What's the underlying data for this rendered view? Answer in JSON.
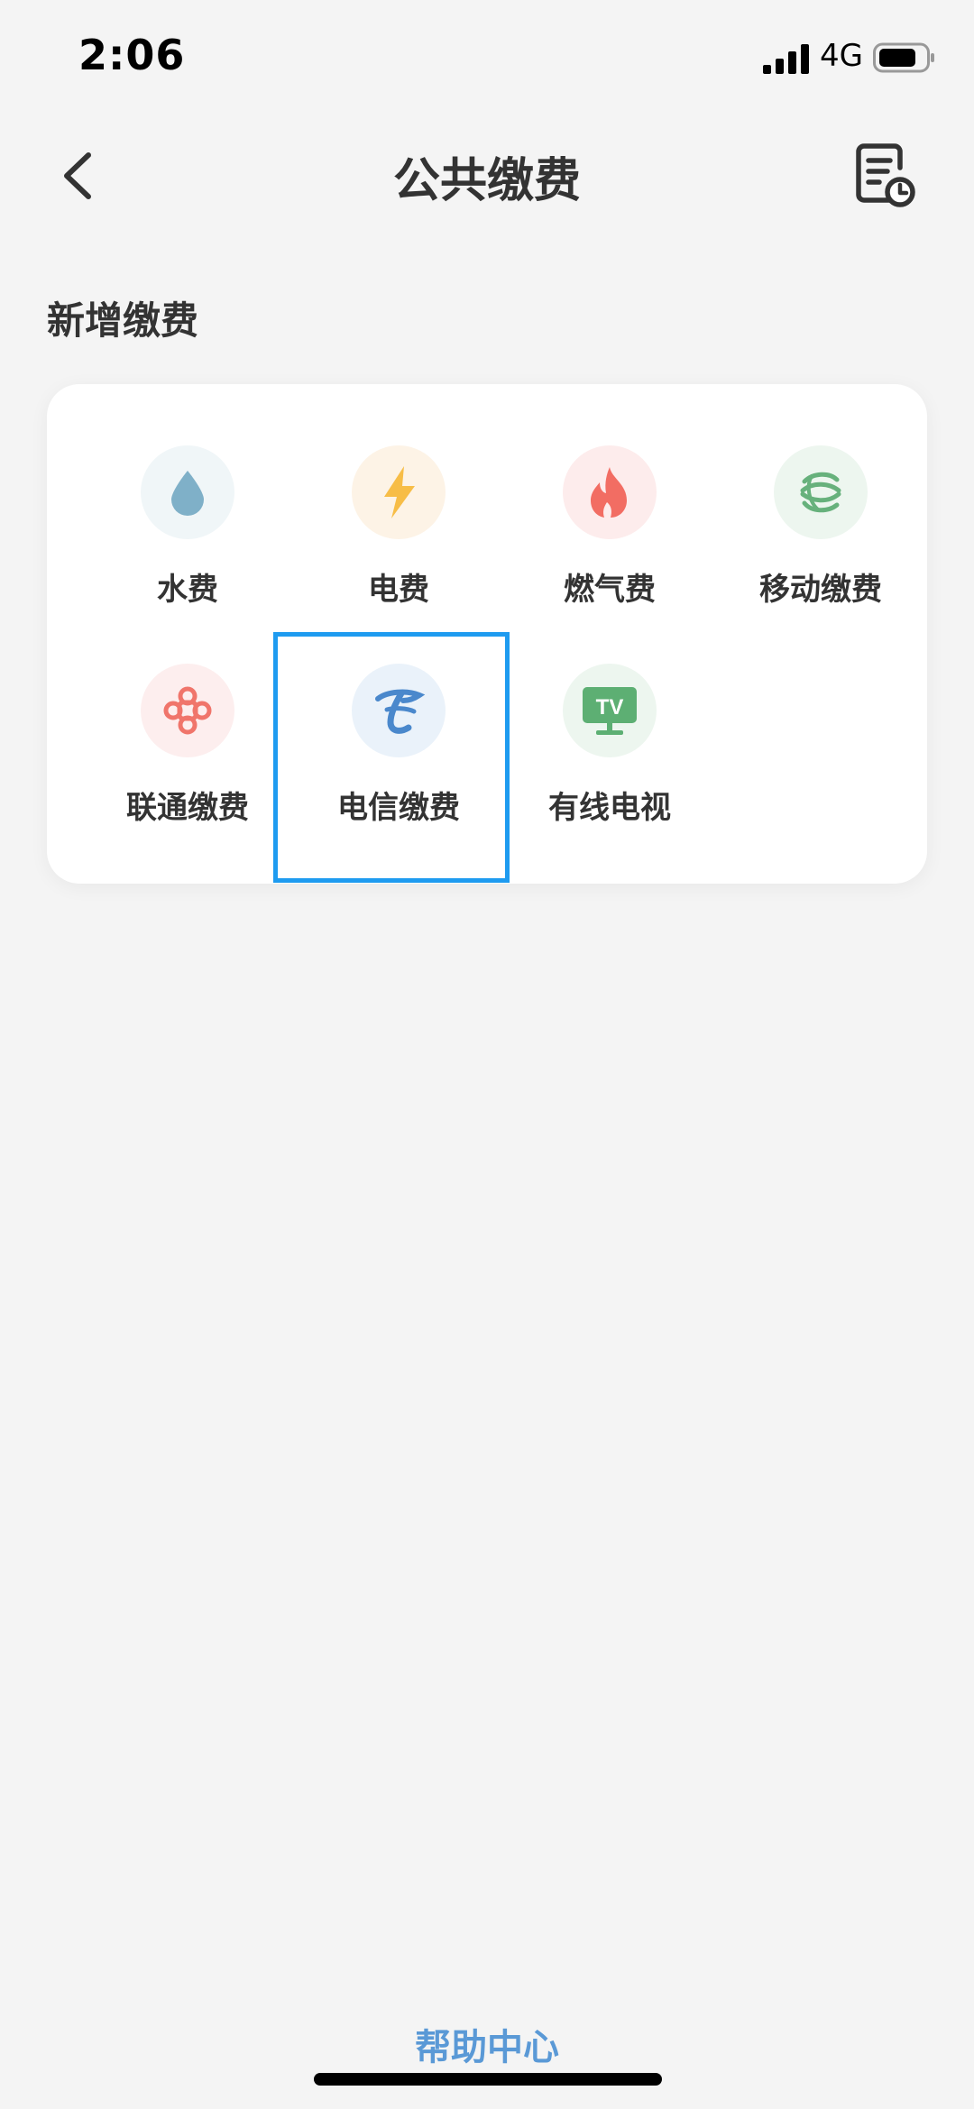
{
  "status_bar": {
    "time": "2:06",
    "network": "4G"
  },
  "nav": {
    "title": "公共缴费"
  },
  "section": {
    "title": "新增缴费"
  },
  "payment_items": [
    {
      "label": "水费",
      "icon": "water-drop-icon",
      "color": "#7fb0c8",
      "bg": "#f0f6f8"
    },
    {
      "label": "电费",
      "icon": "lightning-icon",
      "color": "#f7bd47",
      "bg": "#fdf3e6"
    },
    {
      "label": "燃气费",
      "icon": "flame-icon",
      "color": "#f26d63",
      "bg": "#fdecec"
    },
    {
      "label": "移动缴费",
      "icon": "china-mobile-icon",
      "color": "#67b17c",
      "bg": "#edf6ef"
    },
    {
      "label": "联通缴费",
      "icon": "china-unicom-icon",
      "color": "#f0756b",
      "bg": "#fdeeee"
    },
    {
      "label": "电信缴费",
      "icon": "china-telecom-icon",
      "color": "#4a88cc",
      "bg": "#eaf2fa"
    },
    {
      "label": "有线电视",
      "icon": "tv-icon",
      "color": "#5daf73",
      "bg": "#edf6ef"
    }
  ],
  "footer": {
    "help_label": "帮助中心"
  }
}
